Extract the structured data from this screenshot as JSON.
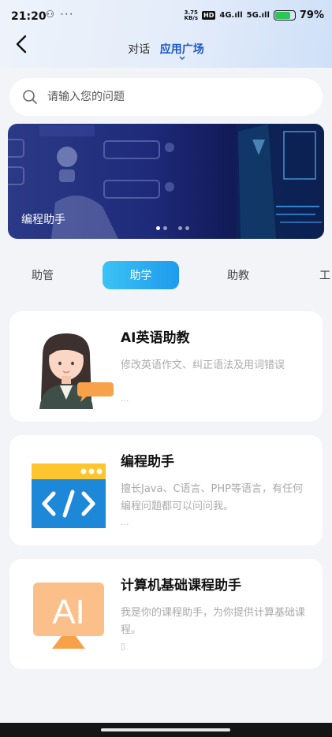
{
  "status_bar": {
    "time": "21:20",
    "left_icons": "⚇ ···",
    "speed_top": "3.75",
    "speed_bottom": "KB/s",
    "hd": "HD",
    "signal_4g": "4G.ıll",
    "signal_5g": "5G.ıll",
    "battery_text": "79%",
    "battery_level": 0.79,
    "battery_color": "#2ec458"
  },
  "nav": {
    "back_icon": "back-arrow-icon",
    "tabs": [
      {
        "label": "对话",
        "active": false
      },
      {
        "label": "应用广场",
        "active": true
      }
    ]
  },
  "search": {
    "placeholder": "请输入您的问题",
    "icon": "search-icon"
  },
  "banner": {
    "title": "编程助手",
    "active_dot": 0,
    "dot_count": 4
  },
  "categories": [
    {
      "label": "助管",
      "active": false
    },
    {
      "label": "助学",
      "active": true
    },
    {
      "label": "助教",
      "active": false
    },
    {
      "label": "工",
      "active": false
    }
  ],
  "cards": [
    {
      "title": "AI英语助教",
      "description": "修改英语作文、纠正语法及用词错误",
      "more": "...",
      "image": "teacher-avatar-icon"
    },
    {
      "title": "编程助手",
      "description": "擅长Java、C语言、PHP等语言，有任何编程问题都可以问问我。",
      "more": "...",
      "image": "code-window-icon"
    },
    {
      "title": "计算机基础课程助手",
      "description": "我是你的课程助手，为你提供计算基础课程。",
      "more": "▯",
      "image": "ai-screen-icon"
    }
  ],
  "colors": {
    "accent": "#1a57c8",
    "tab_active_start": "#3bc3f3",
    "tab_active_end": "#1f9aee"
  }
}
